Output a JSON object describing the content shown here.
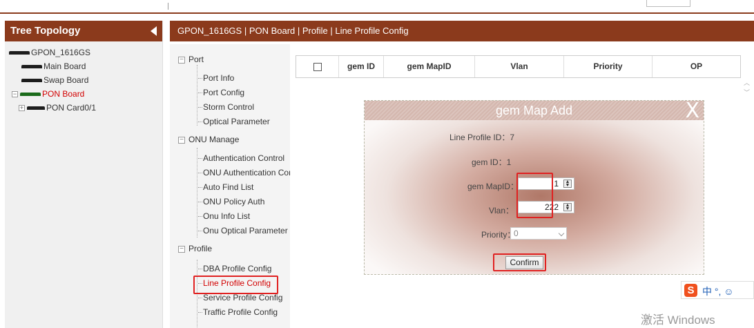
{
  "left_panel": {
    "title": "Tree Topology",
    "tree": [
      {
        "label": "GPON_1616GS"
      },
      {
        "label": "Main Board"
      },
      {
        "label": "Swap Board"
      },
      {
        "label": "PON Board"
      },
      {
        "label": "PON Card0/1"
      }
    ]
  },
  "breadcrumb": "GPON_1616GS | PON Board | Profile | Line Profile Config",
  "menu": {
    "groups": [
      {
        "label": "Port",
        "items": [
          "Port Info",
          "Port Config",
          "Storm Control",
          "Optical Parameter"
        ]
      },
      {
        "label": "ONU Manage",
        "items": [
          "Authentication Control",
          "ONU Authentication Cor",
          "Auto Find List",
          "ONU Policy Auth",
          "Onu Info List",
          "Onu Optical Parameter"
        ]
      },
      {
        "label": "Profile",
        "items": [
          "DBA Profile Config",
          "Line Profile Config",
          "Service Profile Config",
          "Traffic Profile Config"
        ]
      }
    ],
    "active_item": "Line Profile Config"
  },
  "grid": {
    "columns": [
      "gem ID",
      "gem MapID",
      "Vlan",
      "Priority",
      "OP"
    ]
  },
  "dialog": {
    "title": "gem Map Add",
    "close": "X",
    "line_profile_id": "Line Profile ID：7",
    "gem_id": "gem ID：1",
    "gem_mapid_label": "gem MapID：",
    "gem_mapid_value": "1",
    "vlan_label": "Vlan：",
    "vlan_value": "222",
    "priority_label": "Priority：",
    "priority_value": "0",
    "confirm": "Confirm"
  },
  "ime": {
    "logo": "S",
    "text": "中 °, ☺"
  },
  "watermark": "激活 Windows",
  "colors": {
    "header_bg": "#8b3a1c",
    "highlight": "#e02020",
    "active_text": "#d20000"
  }
}
